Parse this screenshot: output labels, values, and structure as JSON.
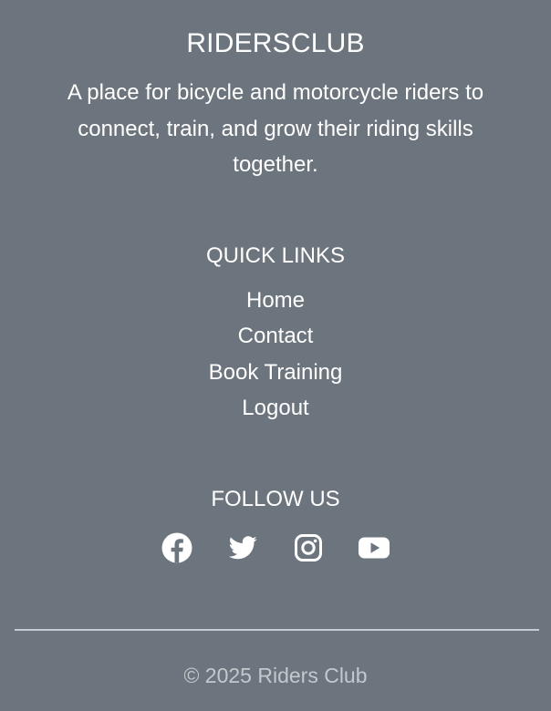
{
  "brand": {
    "title": "RIDERSCLUB",
    "description": "A place for bicycle and motorcycle riders to connect, train, and grow their riding skills together."
  },
  "quick_links": {
    "heading": "QUICK LINKS",
    "items": [
      {
        "label": "Home"
      },
      {
        "label": "Contact"
      },
      {
        "label": "Book Training"
      },
      {
        "label": "Logout"
      }
    ]
  },
  "follow_us": {
    "heading": "FOLLOW US",
    "icons": [
      "facebook-icon",
      "twitter-icon",
      "instagram-icon",
      "youtube-icon"
    ]
  },
  "copyright": "© 2025 Riders Club",
  "colors": {
    "background": "#6c757d",
    "text": "#ffffff",
    "muted_text": "#c3c8cd",
    "divider": "#c6cbd0"
  }
}
